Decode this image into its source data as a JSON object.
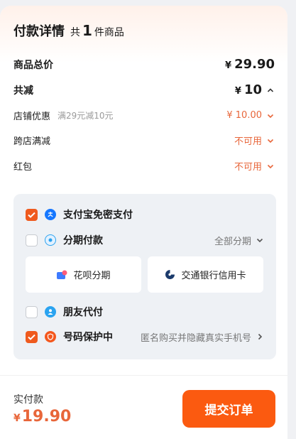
{
  "header": {
    "title": "付款详情",
    "count_prefix": "共",
    "count": "1",
    "count_suffix": "件商品"
  },
  "summary": {
    "total_label": "商品总价",
    "total_yen": "¥",
    "total_value": "29.90",
    "reduce_label": "共减",
    "reduce_yen": "¥",
    "reduce_value": "10",
    "shop_discount_label": "店铺优惠",
    "shop_discount_rule": "满29元减10元",
    "shop_discount_value": "¥ 10.00",
    "cross_shop_label": "跨店满减",
    "cross_shop_value": "不可用",
    "redpacket_label": "红包",
    "redpacket_value": "不可用"
  },
  "payment": {
    "alipay_label": "支付宝免密支付",
    "installment_label": "分期付款",
    "installment_right": "全部分期",
    "huabei_label": "花呗分期",
    "bocom_label": "交通银行信用卡",
    "friend_label": "朋友代付",
    "privacy_label": "号码保护中",
    "privacy_right": "匿名购买并隐藏真实手机号"
  },
  "footer": {
    "label": "实付款",
    "yen": "¥",
    "amount": "19.90",
    "submit_label": "提交订单"
  },
  "colors": {
    "accent": "#fb5a10",
    "price_orange": "#e8663a",
    "panel": "#eef1f5"
  }
}
